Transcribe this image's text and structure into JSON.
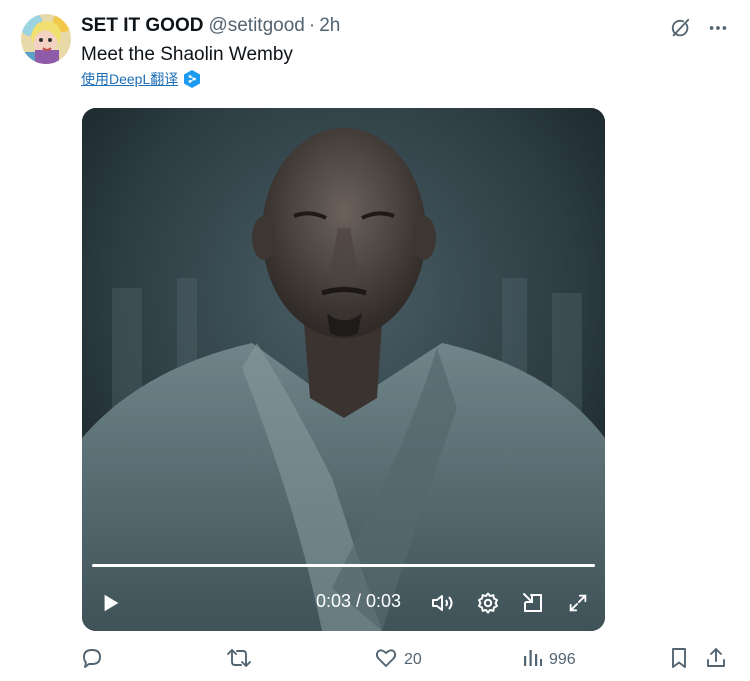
{
  "tweet": {
    "display_name": "SET IT GOOD",
    "handle": "@setitgood",
    "separator": "·",
    "timestamp": "2h",
    "text": "Meet the Shaolin Wemby",
    "translate_label": "使用DeepL翻译"
  },
  "video": {
    "time_display": "0:03 / 0:03",
    "progress": 1.0
  },
  "actions": {
    "likes": "20",
    "views": "996"
  },
  "icons": [
    "grok-icon",
    "more-icon",
    "play-icon",
    "volume-icon",
    "settings-icon",
    "dock-icon",
    "fullscreen-icon",
    "reply-icon",
    "retweet-icon",
    "like-icon",
    "views-icon",
    "bookmark-icon",
    "share-icon"
  ],
  "colors": {
    "secondary_text": "#536471",
    "link": "#1d6fb8",
    "deepl": "#1d9bf0"
  }
}
